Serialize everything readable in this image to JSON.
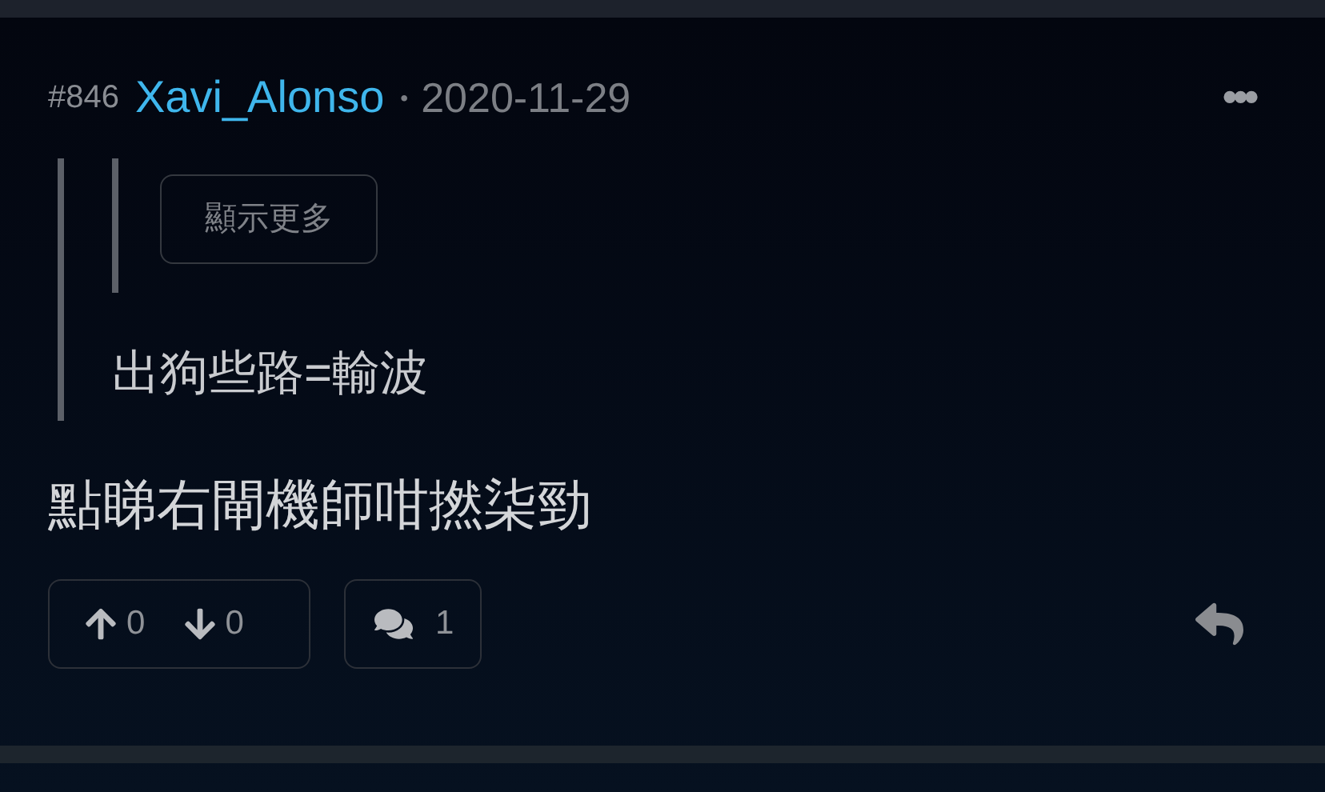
{
  "post": {
    "number": "#846",
    "author": "Xavi_Alonso",
    "separator": "•",
    "date": "2020-11-29",
    "menu": "•••"
  },
  "quote": {
    "nested": {
      "show_more": "顯示更多"
    },
    "text": "出狗些路=輸波"
  },
  "body": "點睇右閘機師咁撚柒勁",
  "actions": {
    "upvotes": "0",
    "downvotes": "0",
    "replies": "1"
  }
}
